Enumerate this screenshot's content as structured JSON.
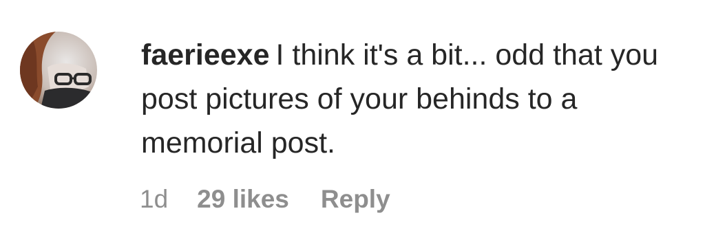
{
  "comment": {
    "username": "faerieexe",
    "text": "I think it's a bit... odd that you post pictures of your behinds to a memorial post.",
    "time": "1d",
    "likes": "29 likes",
    "reply": "Reply"
  },
  "colors": {
    "text": "#262626",
    "meta": "#8e8e8e",
    "background": "#ffffff"
  },
  "icons": {
    "avatar": "user-avatar-photo"
  }
}
